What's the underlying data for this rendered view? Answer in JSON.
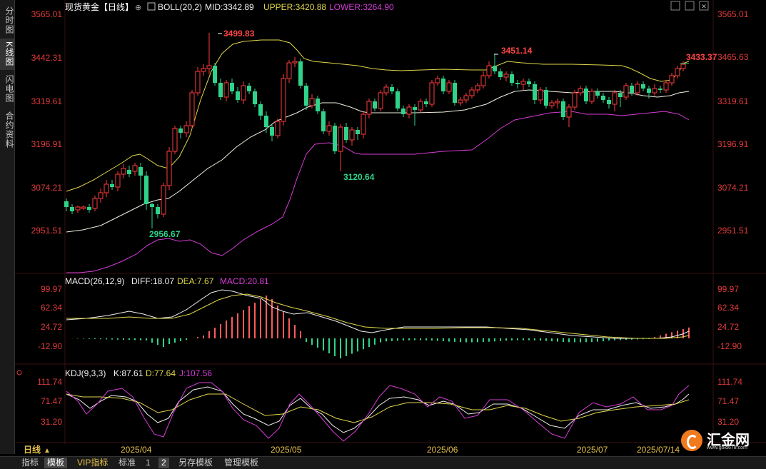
{
  "sidebar": {
    "items": [
      {
        "label": "分时图",
        "active": false
      },
      {
        "label": "K线图",
        "active": true
      },
      {
        "label": "闪电图",
        "active": false
      },
      {
        "label": "合约资料",
        "active": false
      }
    ]
  },
  "header": {
    "title": "现货黄金【日线】",
    "indicator": "BOLL(20,2)",
    "mid": "MID:3342.89",
    "upper": "UPPER:3420.88",
    "lower": "LOWER:3264.90"
  },
  "window_icons": [
    "restore-icon",
    "maximize-icon",
    "minimize-icon",
    "close-icon"
  ],
  "main_axis": {
    "ticks": [
      "3565.01",
      "3442.31",
      "3319.61",
      "3196.91",
      "3074.21",
      "2951.51"
    ],
    "current_price": "3465.63"
  },
  "annotations": {
    "high1": "3499.83",
    "high2": "3451.14",
    "low1": "2956.67",
    "low2": "3120.64",
    "last": "3433.37"
  },
  "macd": {
    "label": "MACD(26,12,9)",
    "diff": "DIFF:18.07",
    "dea": "DEA:7.67",
    "macd": "MACD:20.81",
    "ticks": [
      "99.97",
      "62.34",
      "24.72",
      "-12.90"
    ]
  },
  "kdj": {
    "label": "KDJ(9,3,3)",
    "k": "K:87.61",
    "d": "D:77.64",
    "j": "J:107.56",
    "ticks": [
      "111.74",
      "71.47",
      "31.20"
    ]
  },
  "xaxis": {
    "period_label": "日线",
    "dates": [
      "2025/04",
      "2025/05",
      "2025/06",
      "2025/07"
    ],
    "cursor_date": "2025/07/14"
  },
  "bottom_tabs": [
    {
      "label": "指标",
      "active": false,
      "vip": false
    },
    {
      "label": "模板",
      "active": true,
      "vip": false
    },
    {
      "label": "VIP指标",
      "active": false,
      "vip": true
    },
    {
      "label": "标准",
      "active": false,
      "vip": false
    },
    {
      "label": "1",
      "active": false,
      "vip": false
    },
    {
      "label": "2",
      "active": true,
      "vip": false
    },
    {
      "label": "另存模板",
      "active": false,
      "vip": false
    },
    {
      "label": "管理模板",
      "active": false,
      "vip": false
    }
  ],
  "brand": {
    "name": "汇金网",
    "url": "www.gold678.com"
  },
  "colors": {
    "up": "#ff3c3c",
    "down": "#2fd38a",
    "mid": "#f0f0e0",
    "upper": "#e0d64a",
    "lower": "#d63cd6",
    "axis_red": "#e03a3a"
  }
}
